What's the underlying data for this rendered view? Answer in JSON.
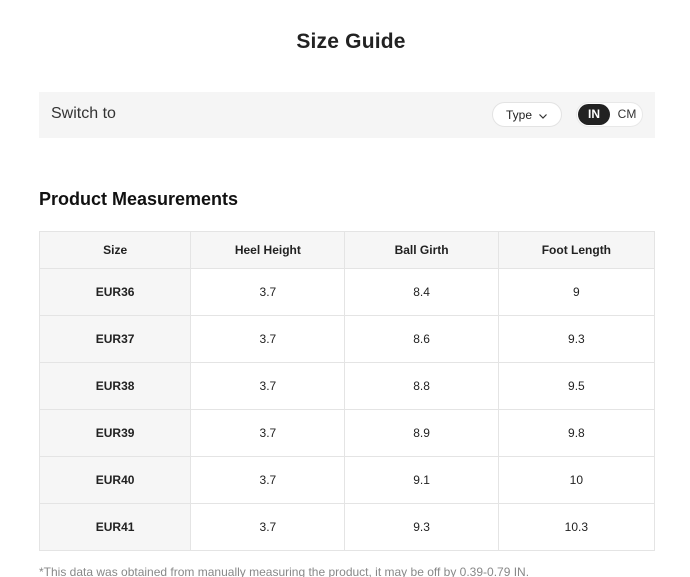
{
  "page": {
    "title": "Size Guide"
  },
  "switch_bar": {
    "label": "Switch to",
    "type_dropdown": "Type",
    "unit_options": [
      "IN",
      "CM"
    ],
    "selected_unit": "IN"
  },
  "measurements": {
    "title": "Product Measurements",
    "columns": [
      "Size",
      "Heel Height",
      "Ball Girth",
      "Foot Length"
    ],
    "rows": [
      [
        "EUR36",
        "3.7",
        "8.4",
        "9"
      ],
      [
        "EUR37",
        "3.7",
        "8.6",
        "9.3"
      ],
      [
        "EUR38",
        "3.7",
        "8.8",
        "9.5"
      ],
      [
        "EUR39",
        "3.7",
        "8.9",
        "9.8"
      ],
      [
        "EUR40",
        "3.7",
        "9.1",
        "10"
      ],
      [
        "EUR41",
        "3.7",
        "9.3",
        "10.3"
      ]
    ]
  },
  "footnote": "*This data was obtained from manually measuring the product, it may be off by 0.39-0.79 IN.",
  "icons": {
    "type_dropdown_icon": "chevron-down-icon"
  },
  "colors": {
    "toggle_active_bg": "#222222",
    "switch_bar_bg": "#f5f5f5",
    "header_bg": "#f6f6f6"
  }
}
